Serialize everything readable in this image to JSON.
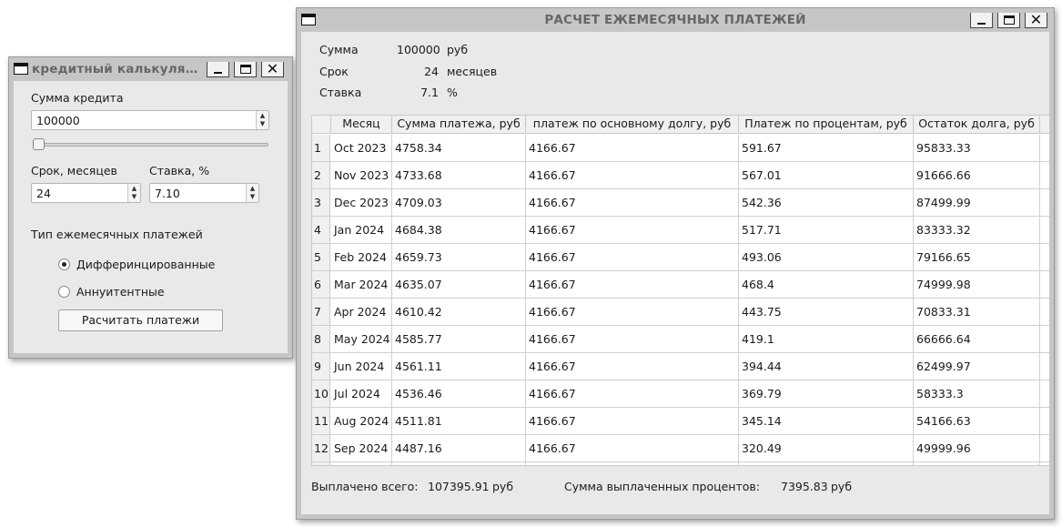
{
  "calculator_window": {
    "title": "кредитный калькулятор",
    "amount_label": "Сумма кредита",
    "amount_value": "100000",
    "amount_slider_fraction": 0.0,
    "term_label": "Срок, месяцев",
    "term_value": "24",
    "rate_label": "Ставка, %",
    "rate_value": "7.10",
    "payment_type_label": "Тип ежемесячных платежей",
    "options": [
      {
        "label": "Дифферинцированные",
        "checked": true
      },
      {
        "label": "Аннуитентные",
        "checked": false
      }
    ],
    "calculate_button": "Расчитать платежи"
  },
  "payments_window": {
    "title": "РАСЧЕТ ЕЖЕМЕСЯЧНЫХ ПЛАТЕЖЕЙ",
    "summary": [
      {
        "label": "Сумма",
        "value": "100000",
        "unit": "руб"
      },
      {
        "label": "Срок",
        "value": "24",
        "unit": "месяцев"
      },
      {
        "label": "Ставка",
        "value": "7.1",
        "unit": "%"
      }
    ],
    "table": {
      "columns": [
        "Месяц",
        "Сумма платежа, руб",
        "платеж по основному долгу, руб",
        "Платеж по процентам, руб",
        "Остаток долга, руб"
      ],
      "rows": [
        {
          "n": "1",
          "cells": [
            "Oct 2023",
            "4758.34",
            "4166.67",
            "591.67",
            "95833.33"
          ]
        },
        {
          "n": "2",
          "cells": [
            "Nov 2023",
            "4733.68",
            "4166.67",
            "567.01",
            "91666.66"
          ]
        },
        {
          "n": "3",
          "cells": [
            "Dec 2023",
            "4709.03",
            "4166.67",
            "542.36",
            "87499.99"
          ]
        },
        {
          "n": "4",
          "cells": [
            "Jan 2024",
            "4684.38",
            "4166.67",
            "517.71",
            "83333.32"
          ]
        },
        {
          "n": "5",
          "cells": [
            "Feb 2024",
            "4659.73",
            "4166.67",
            "493.06",
            "79166.65"
          ]
        },
        {
          "n": "6",
          "cells": [
            "Mar 2024",
            "4635.07",
            "4166.67",
            "468.4",
            "74999.98"
          ]
        },
        {
          "n": "7",
          "cells": [
            "Apr 2024",
            "4610.42",
            "4166.67",
            "443.75",
            "70833.31"
          ]
        },
        {
          "n": "8",
          "cells": [
            "May 2024",
            "4585.77",
            "4166.67",
            "419.1",
            "66666.64"
          ]
        },
        {
          "n": "9",
          "cells": [
            "Jun 2024",
            "4561.11",
            "4166.67",
            "394.44",
            "62499.97"
          ]
        },
        {
          "n": "10",
          "cells": [
            "Jul 2024",
            "4536.46",
            "4166.67",
            "369.79",
            "58333.3"
          ]
        },
        {
          "n": "11",
          "cells": [
            "Aug 2024",
            "4511.81",
            "4166.67",
            "345.14",
            "54166.63"
          ]
        },
        {
          "n": "12",
          "cells": [
            "Sep 2024",
            "4487.16",
            "4166.67",
            "320.49",
            "49999.96"
          ]
        }
      ]
    },
    "footer": {
      "total_label": "Выплачено всего:",
      "total_value": "107395.91",
      "total_unit": "руб",
      "interest_label": "Сумма выплаченных процентов:",
      "interest_value": "7395.83",
      "interest_unit": "руб"
    }
  }
}
